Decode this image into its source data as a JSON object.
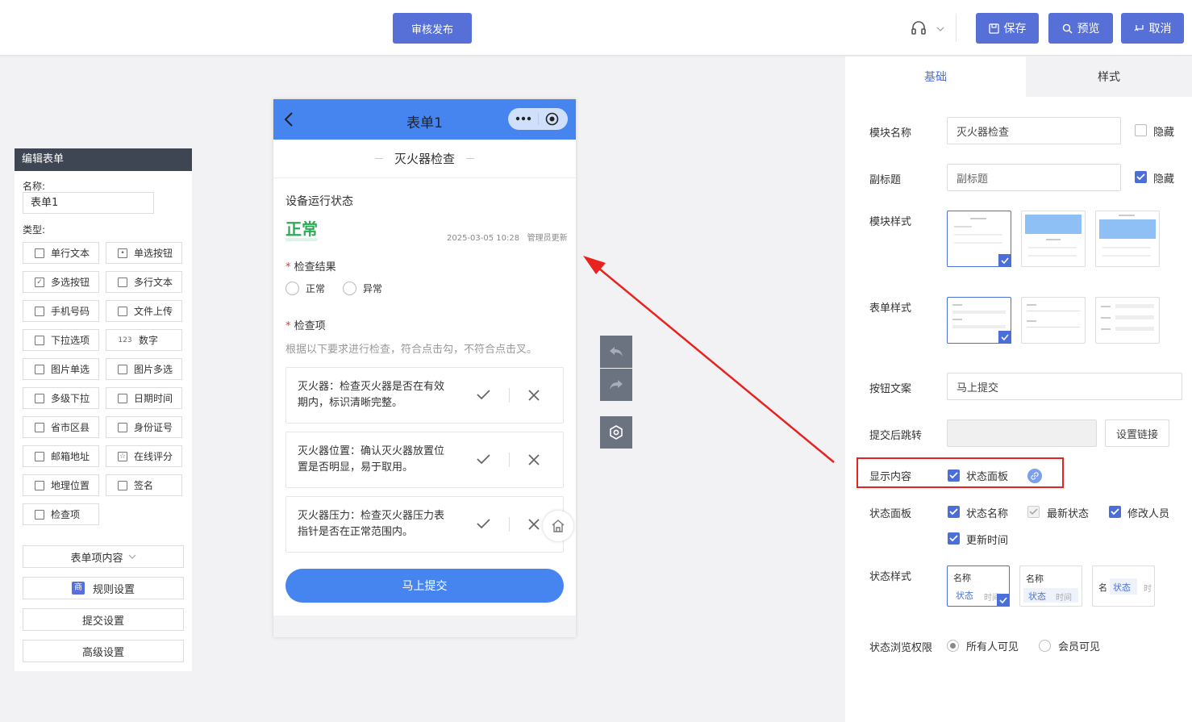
{
  "topbar": {
    "publish_label": "审核发布",
    "save_label": "保存",
    "preview_label": "预览",
    "cancel_label": "取消"
  },
  "left": {
    "header": "编辑表单",
    "name_label": "名称:",
    "name_value": "表单1",
    "type_label": "类型:",
    "types": [
      {
        "label": "单行文本",
        "icon": "text-line-icon"
      },
      {
        "label": "单选按钮",
        "icon": "radio-icon"
      },
      {
        "label": "多选按钮",
        "icon": "checkbox-icon"
      },
      {
        "label": "多行文本",
        "icon": "text-multi-icon"
      },
      {
        "label": "手机号码",
        "icon": "phone-icon"
      },
      {
        "label": "文件上传",
        "icon": "upload-icon"
      },
      {
        "label": "下拉选项",
        "icon": "dropdown-icon"
      },
      {
        "label": "数字",
        "icon": "number-icon"
      },
      {
        "label": "图片单选",
        "icon": "image-single-icon"
      },
      {
        "label": "图片多选",
        "icon": "image-multi-icon"
      },
      {
        "label": "多级下拉",
        "icon": "cascade-icon"
      },
      {
        "label": "日期时间",
        "icon": "calendar-icon"
      },
      {
        "label": "省市区县",
        "icon": "region-icon"
      },
      {
        "label": "身份证号",
        "icon": "idcard-icon"
      },
      {
        "label": "邮箱地址",
        "icon": "mail-icon"
      },
      {
        "label": "在线评分",
        "icon": "star-icon"
      },
      {
        "label": "地理位置",
        "icon": "location-icon"
      },
      {
        "label": "签名",
        "icon": "signature-icon"
      },
      {
        "label": "检查项",
        "icon": "checklist-icon"
      }
    ],
    "form_content_label": "表单项内容",
    "rules_label": "规则设置",
    "rules_badge": "商",
    "submit_settings_label": "提交设置",
    "advanced_label": "高级设置"
  },
  "phone": {
    "title": "表单1",
    "module_title": "灭火器检查",
    "status_heading": "设备运行状态",
    "status_value": "正常",
    "status_time": "2025-03-05 10:28",
    "status_updater": "管理员更新",
    "result_label": "检查结果",
    "result_options": [
      "正常",
      "异常"
    ],
    "items_label": "检查项",
    "items_hint": "根据以下要求进行检查，符合点击勾，不符合点击叉。",
    "items": [
      "灭火器：检查灭火器是否在有效期内，标识清晰完整。",
      "灭火器位置：确认灭火器放置位置是否明显，易于取用。",
      "灭火器压力：检查灭火器压力表指针是否在正常范围内。"
    ],
    "submit_label": "马上提交"
  },
  "right": {
    "tabs": [
      "基础",
      "样式"
    ],
    "module_name_label": "模块名称",
    "module_name_value": "灭火器检查",
    "hide_label": "隐藏",
    "subtitle_label": "副标题",
    "subtitle_placeholder": "副标题",
    "module_style_label": "模块样式",
    "form_style_label": "表单样式",
    "button_text_label": "按钮文案",
    "button_text_value": "马上提交",
    "redirect_label": "提交后跳转",
    "set_link_label": "设置链接",
    "display_label": "显示内容",
    "status_panel_label": "状态面板",
    "panel_label": "状态面板",
    "panel_options": [
      {
        "label": "状态名称",
        "state": "on"
      },
      {
        "label": "最新状态",
        "state": "disabled"
      },
      {
        "label": "修改人员",
        "state": "on"
      },
      {
        "label": "更新时间",
        "state": "on"
      }
    ],
    "status_style_label": "状态样式",
    "status_style_name": "名称",
    "status_style_state": "状态",
    "status_style_time": "时间",
    "status_style_name_short": "名",
    "status_style_time_short": "时",
    "status_style_time_cut": "时间",
    "permission_label": "状态浏览权限",
    "permission_options": [
      "所有人可见",
      "会员可见"
    ]
  },
  "colors": {
    "primary": "#5670d8",
    "phone_nav": "#4684f0",
    "status_ok": "#2bab55",
    "annotation_red": "#e8231f"
  }
}
